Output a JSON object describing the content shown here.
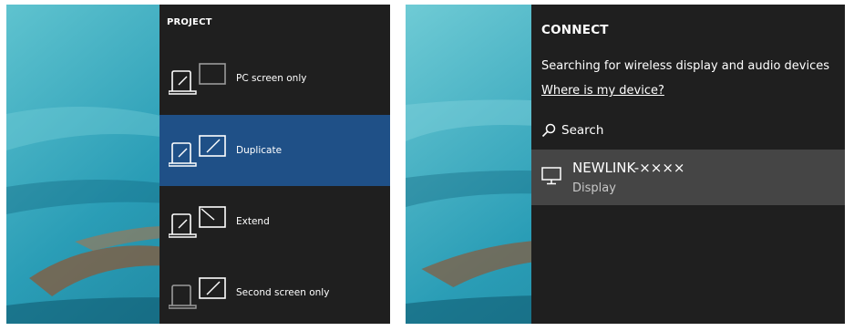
{
  "project": {
    "title": "PROJECT",
    "selected_index": 1,
    "items": [
      {
        "label": "PC screen only",
        "icon": "pc-screen-only-icon"
      },
      {
        "label": "Duplicate",
        "icon": "duplicate-icon"
      },
      {
        "label": "Extend",
        "icon": "extend-icon"
      },
      {
        "label": "Second screen only",
        "icon": "second-screen-only-icon"
      }
    ]
  },
  "connect": {
    "title": "CONNECT",
    "status": "Searching for wireless display and audio devices",
    "help_link": "Where is my device?",
    "search_label": "Search",
    "devices": [
      {
        "name": "NEWLINK-××××",
        "type": "Display",
        "icon": "monitor-icon"
      }
    ]
  },
  "colors": {
    "flyout_bg": "#1f1f1f",
    "selected_bg": "#1f5087",
    "device_row_bg": "#454545",
    "water": "#2a9db6"
  }
}
